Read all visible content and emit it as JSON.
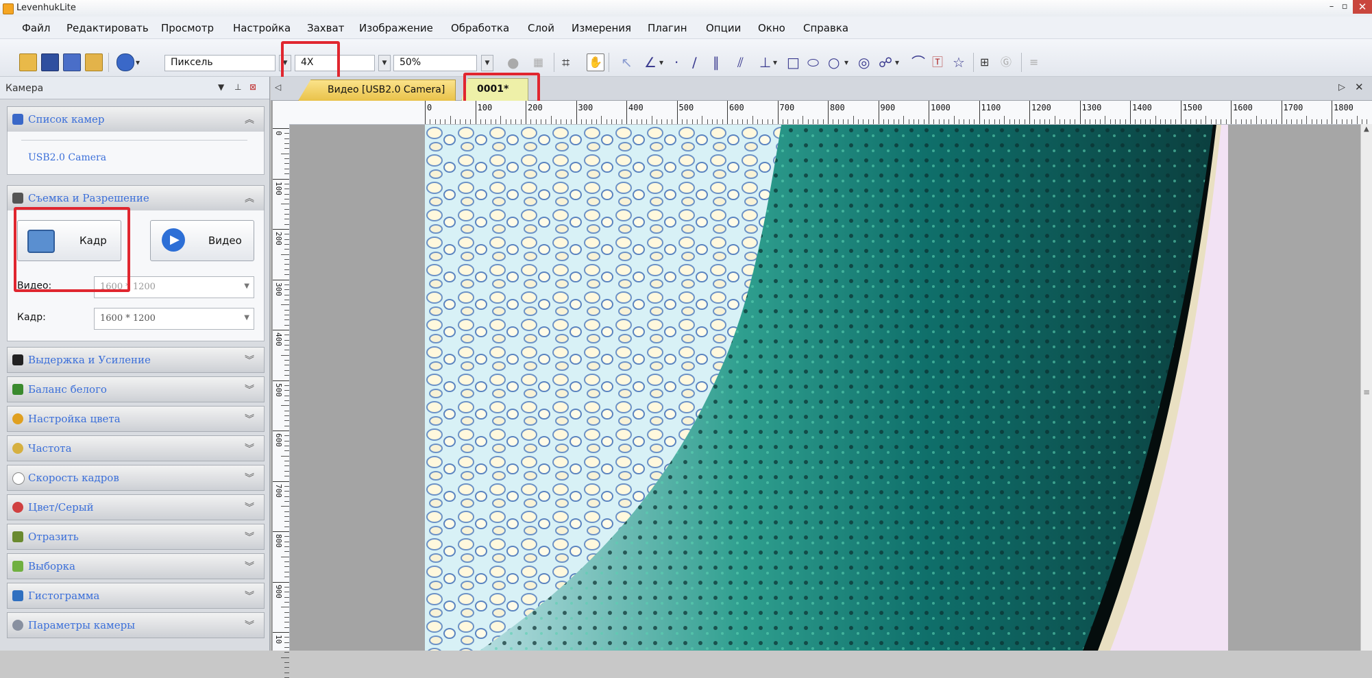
{
  "window": {
    "title": "LevenhukLite",
    "controls": {
      "minimize": "–",
      "maximize": "▫",
      "close": "✕"
    }
  },
  "menu": [
    "Файл",
    "Редактировать",
    "Просмотр",
    "Настройка",
    "Захват",
    "Изображение",
    "Обработка",
    "Слой",
    "Измерения",
    "Плагин",
    "Опции",
    "Окно",
    "Справка"
  ],
  "toolbar": {
    "unit_select": "Пиксель",
    "objective_select": "4X",
    "zoom_select": "50%"
  },
  "left_panel": {
    "title": "Камера",
    "sections": {
      "camera_list": {
        "label": "Список камер",
        "camera_name": "USB2.0 Camera"
      },
      "capture_resolution": {
        "label": "Съемка и Разрешение",
        "snap_button": "Кадр",
        "video_button": "Видео",
        "video_label": "Видео:",
        "video_value": "1600 * 1200",
        "frame_label": "Кадр:",
        "frame_value": "1600 * 1200"
      }
    },
    "collapsed_sections": [
      "Выдержка и Усиление",
      "Баланс белого",
      "Настройка цвета",
      "Частота",
      "Скорость кадров",
      "Цвет/Серый",
      "Отразить",
      "Выборка",
      "Гистограмма",
      "Параметры камеры"
    ],
    "collapsed_icon_colors": [
      "#222222",
      "#3a8a2e",
      "#e0a020",
      "#d6b040",
      "#888888",
      "#d04040",
      "#6a8a30",
      "#70b040",
      "#3070c0",
      "#8890a0"
    ]
  },
  "document": {
    "tabs": [
      "Видео [USB2.0 Camera]",
      "0001*"
    ],
    "ruler_top_ticks": [
      "0",
      "100",
      "200",
      "300",
      "400",
      "500",
      "600",
      "700",
      "800",
      "900",
      "1000",
      "1100",
      "1200",
      "1300",
      "1400",
      "1500",
      "1600",
      "1700",
      "1800"
    ],
    "ruler_left_ticks": [
      "0",
      "100",
      "200",
      "300",
      "400",
      "500",
      "600",
      "700",
      "800",
      "900",
      "10"
    ]
  },
  "colors": {
    "highlight": "#e0262f",
    "section_label": "#3b6fd9",
    "active_tab": "#eef0a8"
  }
}
